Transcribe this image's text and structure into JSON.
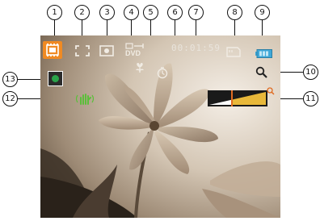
{
  "osd": {
    "time_remaining": "00:01:59",
    "video_format_label": "DVD",
    "zoom_level": 0.4
  },
  "callouts": [
    "1",
    "2",
    "3",
    "4",
    "5",
    "6",
    "7",
    "8",
    "9",
    "10",
    "11",
    "12",
    "13"
  ],
  "icons": {
    "mode": "video-mode-icon",
    "focus": "focus-area-icon",
    "exposure": "metering-icon",
    "resolution": "video-resolution-icon",
    "macro": "macro-icon",
    "selftimer": "self-timer-icon",
    "card": "memory-card-icon",
    "battery": "battery-icon",
    "zoom": "zoom-magnifier-icon",
    "stabilizer": "anti-shake-icon",
    "record": "record-status-icon"
  },
  "colors": {
    "mode_highlight": "#f08a22",
    "zoom_fill": "#e8b83a",
    "zoom_marker": "#e06a20",
    "record_green": "#2aa34a",
    "battery_blue": "#3fa8d8",
    "stabilizer_green": "#5bbf3a"
  }
}
